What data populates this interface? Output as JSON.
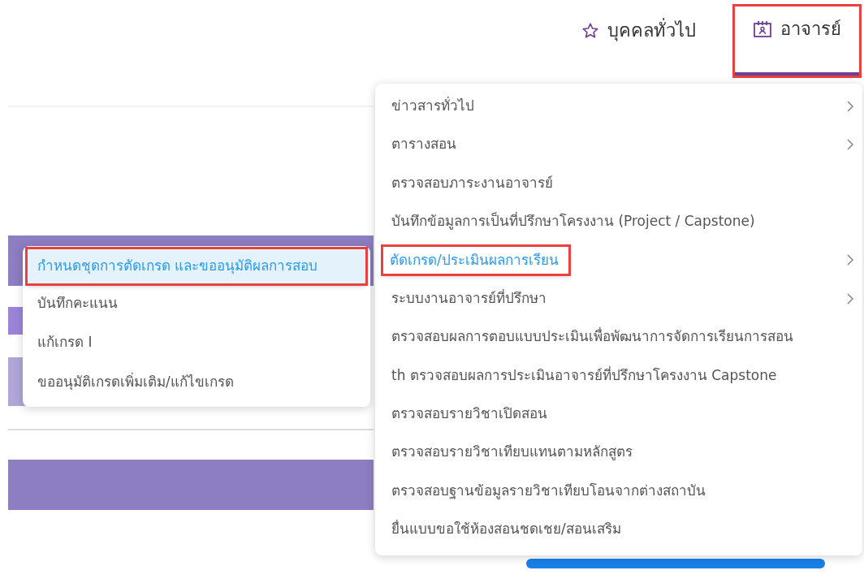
{
  "nav": [
    {
      "label": "บุคคลทั่วไป",
      "kind": "star",
      "selected": false
    },
    {
      "label": "อาจารย์",
      "kind": "calendar",
      "selected": true
    }
  ],
  "menu": [
    {
      "label": "ข่าวสารทั่วไป",
      "submenu": true,
      "selected": false
    },
    {
      "label": "ตารางสอน",
      "submenu": true,
      "selected": false
    },
    {
      "label": "ตรวจสอบภาระงานอาจารย์",
      "submenu": false,
      "selected": false
    },
    {
      "label": "บันทึกข้อมูลการเป็นที่ปรึกษาโครงงาน (Project / Capstone)",
      "submenu": false,
      "selected": false
    },
    {
      "label": "ตัดเกรด/ประเมินผลการเรียน",
      "submenu": true,
      "selected": true
    },
    {
      "label": "ระบบงานอาจารย์ที่ปรึกษา",
      "submenu": true,
      "selected": false
    },
    {
      "label": "ตรวจสอบผลการตอบแบบประเมินเพื่อพัฒนาการจัดการเรียนการสอน",
      "submenu": false,
      "selected": false
    },
    {
      "label": "th ตรวจสอบผลการประเมินอาจารย์ที่ปรึกษาโครงงาน Capstone",
      "submenu": false,
      "selected": false
    },
    {
      "label": "ตรวจสอบรายวิชาเปิดสอน",
      "submenu": false,
      "selected": false
    },
    {
      "label": "ตรวจสอบรายวิชาเทียบแทนตามหลักสูตร",
      "submenu": false,
      "selected": false
    },
    {
      "label": "ตรวจสอบฐานข้อมูลรายวิชาเทียบโอนจากต่างสถาบัน",
      "submenu": false,
      "selected": false
    },
    {
      "label": "ยื่นแบบขอใช้ห้องสอนชดเชย/สอนเสริม",
      "submenu": false,
      "selected": false
    }
  ],
  "submenu": [
    {
      "label": "กำหนดชุดการตัดเกรด และขออนุมัติผลการสอบ",
      "selected": true
    },
    {
      "label": "บันทึกคะแนน",
      "selected": false
    },
    {
      "label": "แก้เกรด I",
      "selected": false
    },
    {
      "label": "ขออนุมัติเกรดเพิ่มเติม/แก้ไขเกรด",
      "selected": false
    }
  ]
}
